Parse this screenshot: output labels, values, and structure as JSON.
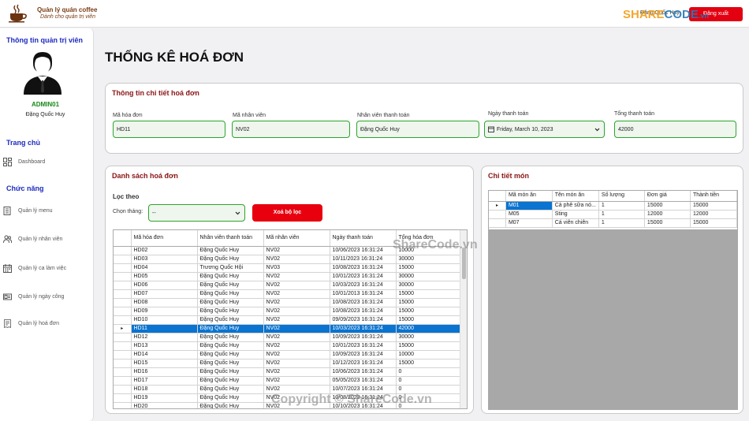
{
  "app": {
    "title": "Quản lý quán coffee",
    "subtitle": "Dành cho quản trị viên"
  },
  "top": {
    "user": "Đặng Quốc Huy",
    "logout_label": "Đăng xuất"
  },
  "watermark": {
    "logo_share": "SHARE",
    "logo_code": "CODE",
    "logo_tld": ".vn",
    "center": "ShareCode.vn",
    "bottom": "Copyright © ShareCode.vn"
  },
  "sidebar": {
    "title": "Thông tin quản trị viên",
    "admin_code": "ADMIN01",
    "admin_name": "Đặng Quốc Huy",
    "home_section": "Trang chủ",
    "dashboard": "Dashboard",
    "func_section": "Chức năng",
    "items": [
      {
        "label": "Quản lý menu",
        "icon": "menu-book-icon"
      },
      {
        "label": "Quản lý nhân viên",
        "icon": "users-icon"
      },
      {
        "label": "Quản lý ca làm việc",
        "icon": "calendar-icon"
      },
      {
        "label": "Quản lý ngày công",
        "icon": "timecard-icon"
      },
      {
        "label": "Quản lý hoá đơn",
        "icon": "invoice-icon"
      }
    ]
  },
  "page_title": "THỐNG KÊ HOÁ ĐƠN",
  "invoice_info": {
    "title": "Thông tin chi tiết hoá đơn",
    "invoice_id_label": "Mã hóa đơn",
    "invoice_id": "HD11",
    "employee_id_label": "Mã nhân viên",
    "employee_id": "NV02",
    "employee_name_label": "Nhân viên thanh toán",
    "employee_name": "Đặng Quốc Huy",
    "pay_date_label": "Ngày thanh toán",
    "pay_date": "Friday, March 10, 2023",
    "total_label": "Tổng thanh toán",
    "total": "42000"
  },
  "invoice_list": {
    "title": "Danh sách hoá đơn",
    "filter_label": "Lọc theo",
    "month_label": "Chọn tháng:",
    "month_value": "--",
    "clear_label": "Xoá bộ lọc",
    "columns": [
      "Mã hóa đơn",
      "Nhân viên thanh toán",
      "Mã nhân viên",
      "Ngày thanh toán",
      "Tổng hóa đơn"
    ],
    "rows": [
      [
        "HD02",
        "Đặng Quốc Huy",
        "NV02",
        "10/06/2023 16:31:24",
        "10000"
      ],
      [
        "HD03",
        "Đặng Quốc Huy",
        "NV02",
        "10/11/2023 16:31:24",
        "30000"
      ],
      [
        "HD04",
        "Trương Quốc Hội",
        "NV03",
        "10/08/2023 16:31:24",
        "15000"
      ],
      [
        "HD05",
        "Đặng Quốc Huy",
        "NV02",
        "10/01/2023 16:31:24",
        "30000"
      ],
      [
        "HD06",
        "Đặng Quốc Huy",
        "NV02",
        "10/03/2023 16:31:24",
        "30000"
      ],
      [
        "HD07",
        "Đặng Quốc Huy",
        "NV02",
        "10/01/2013 16:31:24",
        "15000"
      ],
      [
        "HD08",
        "Đặng Quốc Huy",
        "NV02",
        "10/08/2023 16:31:24",
        "15000"
      ],
      [
        "HD09",
        "Đặng Quốc Huy",
        "NV02",
        "10/08/2023 16:31:24",
        "15000"
      ],
      [
        "HD10",
        "Đặng Quốc Huy",
        "NV02",
        "09/09/2023 16:31:24",
        "15000"
      ],
      [
        "HD11",
        "Đặng Quốc Huy",
        "NV02",
        "10/03/2023 16:31:24",
        "42000"
      ],
      [
        "HD12",
        "Đặng Quốc Huy",
        "NV02",
        "10/09/2023 16:31:24",
        "30000"
      ],
      [
        "HD13",
        "Đặng Quốc Huy",
        "NV02",
        "10/01/2023 16:31:24",
        "15000"
      ],
      [
        "HD14",
        "Đặng Quốc Huy",
        "NV02",
        "10/09/2023 16:31:24",
        "10000"
      ],
      [
        "HD15",
        "Đặng Quốc Huy",
        "NV02",
        "10/12/2023 16:31:24",
        "15000"
      ],
      [
        "HD16",
        "Đặng Quốc Huy",
        "NV02",
        "10/06/2023 16:31:24",
        "0"
      ],
      [
        "HD17",
        "Đặng Quốc Huy",
        "NV02",
        "05/05/2023 16:31:24",
        "0"
      ],
      [
        "HD18",
        "Đặng Quốc Huy",
        "NV02",
        "10/07/2023 16:31:24",
        "0"
      ],
      [
        "HD19",
        "Đặng Quốc Huy",
        "NV02",
        "10/08/2023 16:31:24",
        "0"
      ],
      [
        "HD20",
        "Đặng Quốc Huy",
        "NV02",
        "10/10/2023 16:31:24",
        "0"
      ]
    ],
    "selected_index": 9
  },
  "detail": {
    "title": "Chi tiết món",
    "columns": [
      "Mã món ăn",
      "Tên món ăn",
      "Số lượng",
      "Đơn giá",
      "Thành tiền"
    ],
    "rows": [
      [
        "M01",
        "Cà phê sữa nó...",
        "1",
        "15000",
        "15000"
      ],
      [
        "M05",
        "Sting",
        "1",
        "12000",
        "12000"
      ],
      [
        "M07",
        "Cá viên chiên",
        "1",
        "15000",
        "15000"
      ]
    ]
  }
}
